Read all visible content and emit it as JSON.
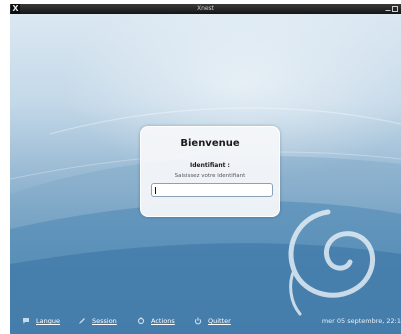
{
  "window": {
    "title": "Xnest",
    "app_icon": "X"
  },
  "login": {
    "welcome": "Bienvenue",
    "id_label": "Identifiant :",
    "id_hint": "Saisissez votre identifiant",
    "id_value": ""
  },
  "bottom_bar": {
    "langue": "Langue",
    "session": "Session",
    "actions": "Actions",
    "quitter": "Quitter",
    "datetime": "mer 05 septembre, 22:1"
  },
  "icons": {
    "langue": "speech-bubble-icon",
    "session": "pen-icon",
    "actions": "actions-icon",
    "quitter": "power-icon"
  },
  "colors": {
    "bg_top": "#dbe8f2",
    "bg_bottom": "#3a76a6",
    "titlebar": "#1e1e1e"
  }
}
